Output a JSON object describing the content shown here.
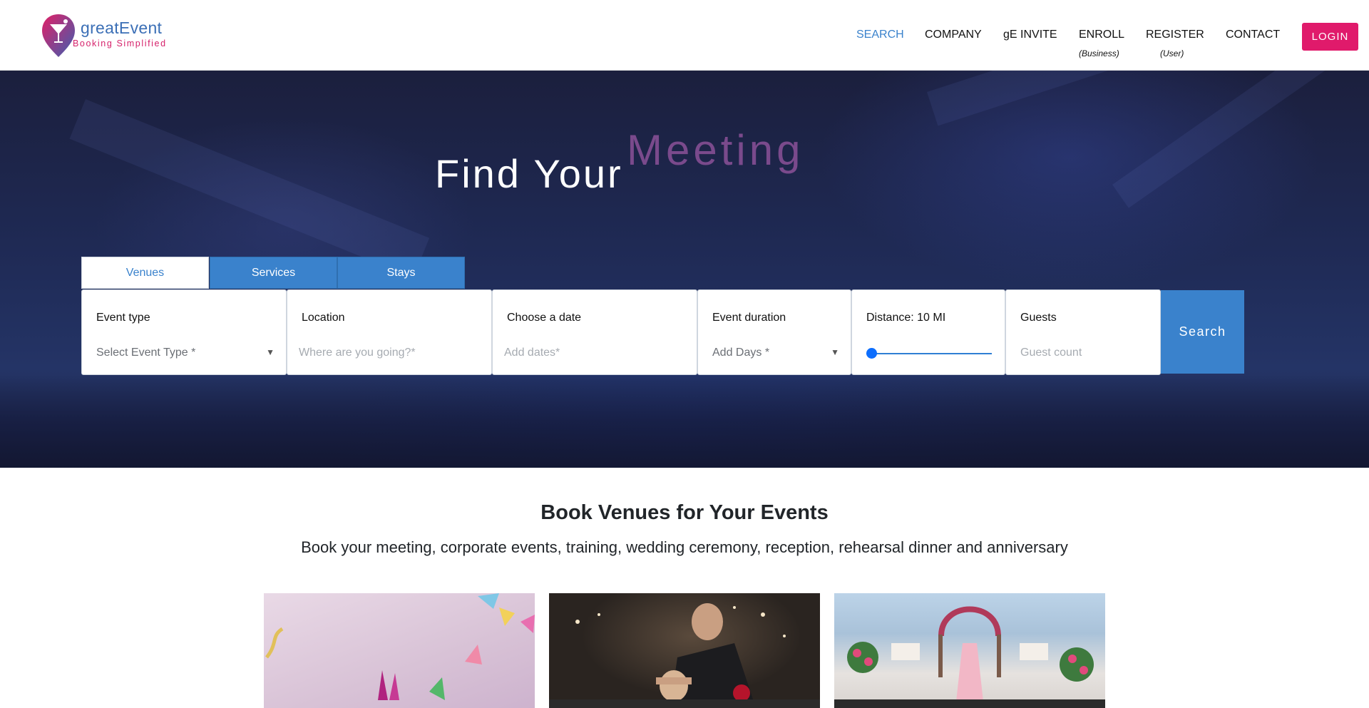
{
  "brand": {
    "name": "greatEvent",
    "tagline": "Booking Simplified",
    "colors": {
      "pink": "#e01a6b",
      "blue": "#3a82cc"
    }
  },
  "nav": {
    "search": "SEARCH",
    "company": "COMPANY",
    "invite": "gE INVITE",
    "enroll": "ENROLL",
    "enroll_sub": "(Business)",
    "register": "REGISTER",
    "register_sub": "(User)",
    "contact": "CONTACT",
    "login": "LOGIN"
  },
  "hero": {
    "title": "Find Your",
    "rotating_word": "Meeting"
  },
  "tabs": [
    {
      "label": "Venues",
      "active": true
    },
    {
      "label": "Services",
      "active": false
    },
    {
      "label": "Stays",
      "active": false
    }
  ],
  "search_form": {
    "event_type": {
      "label": "Event type",
      "value": "Select Event Type *"
    },
    "location": {
      "label": "Location",
      "placeholder": "Where are you going?*"
    },
    "date": {
      "label": "Choose a date",
      "placeholder": "Add dates*"
    },
    "duration": {
      "label": "Event duration",
      "value": "Add Days *"
    },
    "distance": {
      "label": "Distance: 10 MI",
      "value_mi": 10
    },
    "guests": {
      "label": "Guests",
      "placeholder": "Guest count"
    },
    "submit": "Search"
  },
  "section": {
    "title": "Book Venues for Your Events",
    "subtitle": "Book your meeting, corporate events, training, wedding ceremony, reception, rehearsal dinner and anniversary"
  },
  "cards": [
    {
      "icon": "party-photo"
    },
    {
      "icon": "couple-photo"
    },
    {
      "icon": "beach-wedding-photo"
    }
  ]
}
